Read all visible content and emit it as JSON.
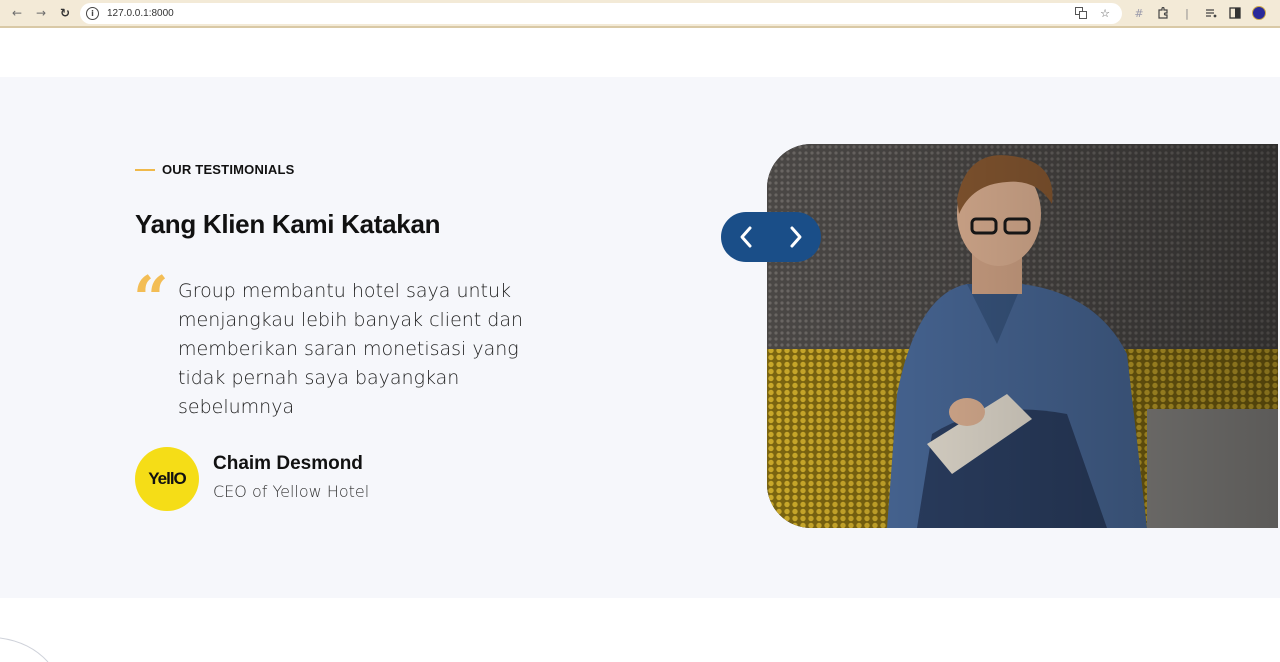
{
  "browser": {
    "url": "127.0.0.1:8000",
    "icons": [
      "back-icon",
      "forward-icon",
      "reload-icon",
      "info-icon",
      "translate-icon",
      "bookmark-star-icon",
      "extension-icon",
      "extensions-puzzle-icon",
      "media-icon",
      "sidebar-icon",
      "profile-icon",
      "menu-icon"
    ]
  },
  "testimonials": {
    "eyebrow": "OUR TESTIMONIALS",
    "heading": "Yang Klien Kami Katakan",
    "quote_mark": "“",
    "quote": "Group membantu hotel saya untuk menjangkau lebih banyak client dan memberikan saran monetisasi yang tidak pernah saya bayangkan sebelumnya",
    "author": {
      "name": "Chaim Desmond",
      "role": "CEO of Yellow Hotel",
      "avatar_logo": "YellO"
    },
    "nav": {
      "prev_icon": "chevron-left-icon",
      "next_icon": "chevron-right-icon"
    }
  },
  "colors": {
    "accent": "#f0b94a",
    "nav_button": "#1a4e88",
    "section_bg": "#f6f7fb",
    "avatar_bg": "#f5dd17"
  }
}
